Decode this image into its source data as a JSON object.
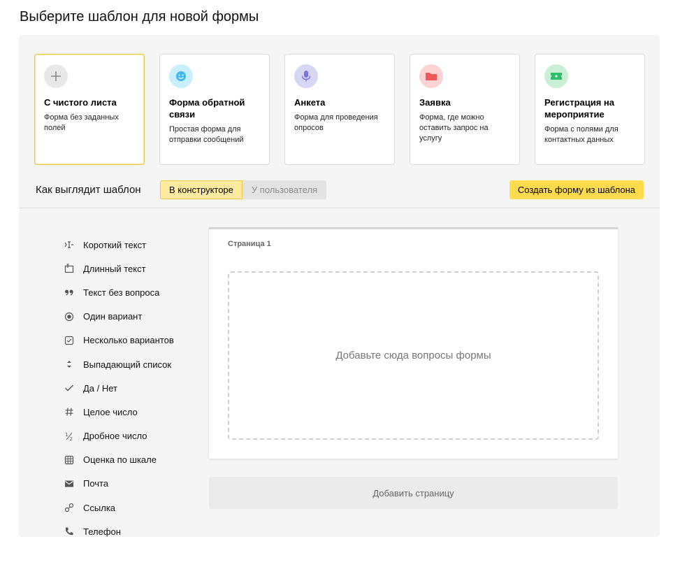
{
  "page_title": "Выберите шаблон для новой формы",
  "templates": [
    {
      "title": "С чистого листа",
      "desc": "Форма без заданных полей",
      "icon": "plus-icon",
      "color": "#e8e8e8",
      "fg": "#888888"
    },
    {
      "title": "Форма обратной связи",
      "desc": "Простая форма для отправки сообщений",
      "icon": "smile-icon",
      "color": "#c9eefc",
      "fg": "#3fb8ef"
    },
    {
      "title": "Анкета",
      "desc": "Форма для проведения опросов",
      "icon": "microphone-icon",
      "color": "#d7d7f5",
      "fg": "#7b74e0"
    },
    {
      "title": "Заявка",
      "desc": "Форма, где можно оставить запрос на услугу",
      "icon": "folder-icon",
      "color": "#fcd3d3",
      "fg": "#f0595b"
    },
    {
      "title": "Регистрация на мероприятие",
      "desc": "Форма с полями для контактных данных",
      "icon": "ticket-icon",
      "color": "#c9efd4",
      "fg": "#2fbf6b"
    }
  ],
  "view": {
    "label": "Как выглядит шаблон",
    "tab_constructor": "В конструкторе",
    "tab_user": "У пользователя",
    "create_button": "Создать форму из шаблона"
  },
  "fields": [
    {
      "label": "Короткий текст",
      "icon": "short-text-icon"
    },
    {
      "label": "Длинный текст",
      "icon": "long-text-icon"
    },
    {
      "label": "Текст без вопроса",
      "icon": "quote-icon"
    },
    {
      "label": "Один вариант",
      "icon": "radio-icon"
    },
    {
      "label": "Несколько вариантов",
      "icon": "checkbox-icon"
    },
    {
      "label": "Выпадающий список",
      "icon": "dropdown-icon"
    },
    {
      "label": "Да / Нет",
      "icon": "check-icon"
    },
    {
      "label": "Целое число",
      "icon": "hash-icon"
    },
    {
      "label": "Дробное число",
      "icon": "fraction-icon"
    },
    {
      "label": "Оценка по шкале",
      "icon": "grid-icon"
    },
    {
      "label": "Почта",
      "icon": "mail-icon"
    },
    {
      "label": "Ссылка",
      "icon": "link-icon"
    },
    {
      "label": "Телефон",
      "icon": "phone-icon"
    }
  ],
  "canvas": {
    "page_label": "Страница 1",
    "dropzone_text": "Добавьте сюда вопросы формы"
  },
  "add_page_button": "Добавить страницу"
}
